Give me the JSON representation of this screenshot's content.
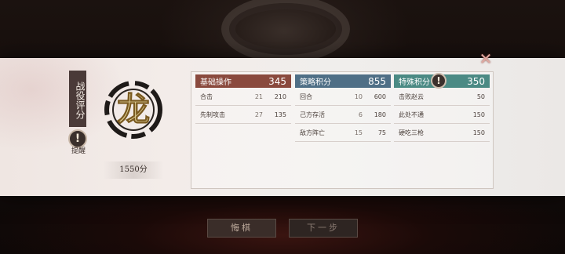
{
  "rating": {
    "label": "战役评分",
    "grade_char": "龙",
    "total_score": "1550分",
    "alert_label": "提醒"
  },
  "close_icon": "close-icon",
  "columns": [
    {
      "title": "基础操作",
      "points": "345",
      "color": "#8a4a3e",
      "rows": [
        {
          "name": "合击",
          "count": "21",
          "score": "210"
        },
        {
          "name": "先制攻击",
          "count": "27",
          "score": "135"
        }
      ]
    },
    {
      "title": "策略积分",
      "points": "855",
      "color": "#4f6f86",
      "rows": [
        {
          "name": "回合",
          "count": "10",
          "score": "600"
        },
        {
          "name": "己方存活",
          "count": "6",
          "score": "180"
        },
        {
          "name": "敌方阵亡",
          "count": "15",
          "score": "75"
        }
      ]
    },
    {
      "title": "特殊积分",
      "points": "350",
      "color": "#4b8a84",
      "rows": [
        {
          "name": "击败赵云",
          "count": "",
          "score": "50"
        },
        {
          "name": "此处不通",
          "count": "",
          "score": "150"
        },
        {
          "name": "硬吃三枪",
          "count": "",
          "score": "150"
        }
      ]
    }
  ],
  "buttons": {
    "undo": "悔棋",
    "next": "下一步"
  }
}
